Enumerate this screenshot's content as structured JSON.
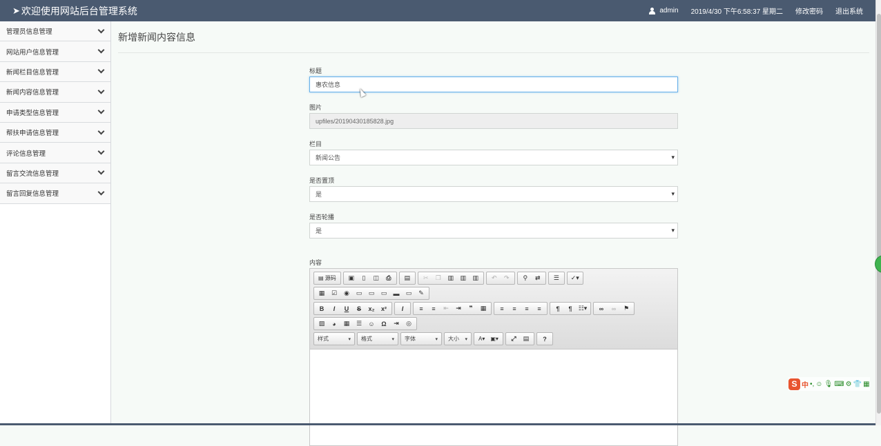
{
  "header": {
    "title": "欢迎使用网站后台管理系统",
    "username": "admin",
    "datetime": "2019/4/30 下午6:58:37 星期二",
    "change_password": "修改密码",
    "logout": "退出系统"
  },
  "sidebar": {
    "items": [
      {
        "label": "管理员信息管理"
      },
      {
        "label": "网站用户信息管理"
      },
      {
        "label": "新闻栏目信息管理"
      },
      {
        "label": "新闻内容信息管理"
      },
      {
        "label": "申请类型信息管理"
      },
      {
        "label": "帮扶申请信息管理"
      },
      {
        "label": "评论信息管理"
      },
      {
        "label": "留言交流信息管理"
      },
      {
        "label": "留言回复信息管理"
      }
    ]
  },
  "page": {
    "title": "新增新闻内容信息"
  },
  "form": {
    "title_label": "标题",
    "title_value": "惠农信息",
    "image_label": "图片",
    "image_value": "upfiles/20190430185828.jpg",
    "column_label": "栏目",
    "column_value": "新闻公告",
    "top_label": "是否置顶",
    "top_value": "是",
    "carousel_label": "是否轮播",
    "carousel_value": "是",
    "content_label": "内容"
  },
  "editor": {
    "source_label": "源码",
    "style_label": "样式",
    "format_label": "格式",
    "font_label": "字体",
    "size_label": "大小",
    "help_label": "?"
  },
  "ime": {
    "chinese": "中"
  }
}
